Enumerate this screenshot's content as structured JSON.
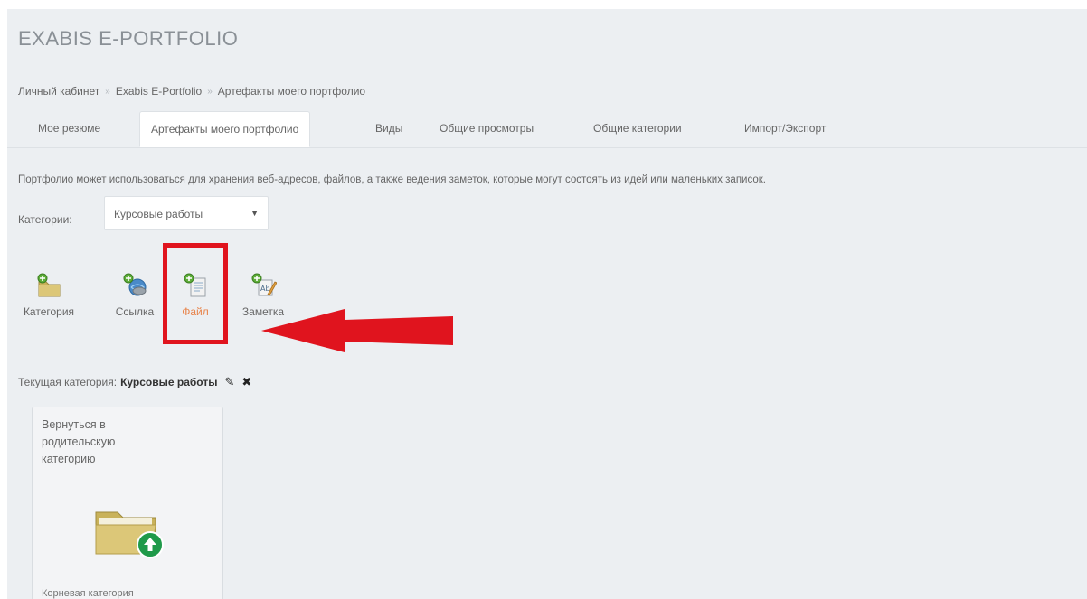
{
  "app": {
    "title": "EXABIS E-PORTFOLIO"
  },
  "breadcrumb": {
    "items": [
      "Личный кабинет",
      "Exabis E-Portfolio",
      "Артефакты моего портфолио"
    ],
    "separator": "»"
  },
  "tabs": [
    {
      "label": "Мое резюме",
      "active": false
    },
    {
      "label": "Артефакты моего портфолио",
      "active": true
    },
    {
      "label": "Виды",
      "active": false
    },
    {
      "label": "Общие просмотры",
      "active": false
    },
    {
      "label": "Общие категории",
      "active": false
    },
    {
      "label": "Импорт/Экспорт",
      "active": false
    }
  ],
  "description": "Портфолио может использоваться для хранения веб-адресов, файлов, а также ведения заметок, которые могут состоять из идей или маленьких записок.",
  "category_filter": {
    "label": "Категории:",
    "selected": "Курсовые работы"
  },
  "toolbar": {
    "items": [
      {
        "label": "Категория",
        "icon": "folder-add-icon"
      },
      {
        "label": "Ссылка",
        "icon": "link-add-icon"
      },
      {
        "label": "Файл",
        "icon": "file-add-icon"
      },
      {
        "label": "Заметка",
        "icon": "note-add-icon"
      }
    ]
  },
  "current_category": {
    "label": "Текущая категория:",
    "name": "Курсовые работы"
  },
  "card": {
    "title": "Вернуться в родительскую категорию",
    "footer": "Корневая категория"
  },
  "colors": {
    "highlight": "#e0141e",
    "accent": "#e8834a",
    "background": "#eceff2"
  }
}
